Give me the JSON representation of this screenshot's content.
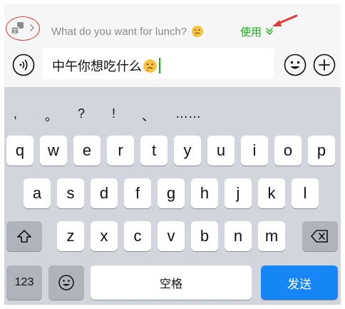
{
  "suggestion": {
    "translation_text": "What do you want for lunch?",
    "use_label": "使用"
  },
  "input": {
    "value": "中午你想吃什么"
  },
  "punctuation": [
    ",",
    "。",
    "?",
    "!",
    "、",
    "……"
  ],
  "keyboard": {
    "row1": [
      "q",
      "w",
      "e",
      "r",
      "t",
      "y",
      "u",
      "i",
      "o",
      "p"
    ],
    "row2": [
      "a",
      "s",
      "d",
      "f",
      "g",
      "h",
      "j",
      "k",
      "l"
    ],
    "row3": [
      "z",
      "x",
      "c",
      "v",
      "b",
      "n",
      "m"
    ],
    "numbers_label": "123",
    "space_label": "空格",
    "send_label": "发送"
  },
  "colors": {
    "accent_green": "#1aad19",
    "send_blue": "#1686f7",
    "annotation_red": "#e23a3a"
  },
  "icons": [
    "translate-icon",
    "chevron-right-icon",
    "thinking-emoji-icon",
    "chevron-down-icon",
    "voice-icon",
    "emoji-icon",
    "plus-icon",
    "shift-icon",
    "backspace-icon",
    "annotation-arrow-icon"
  ]
}
